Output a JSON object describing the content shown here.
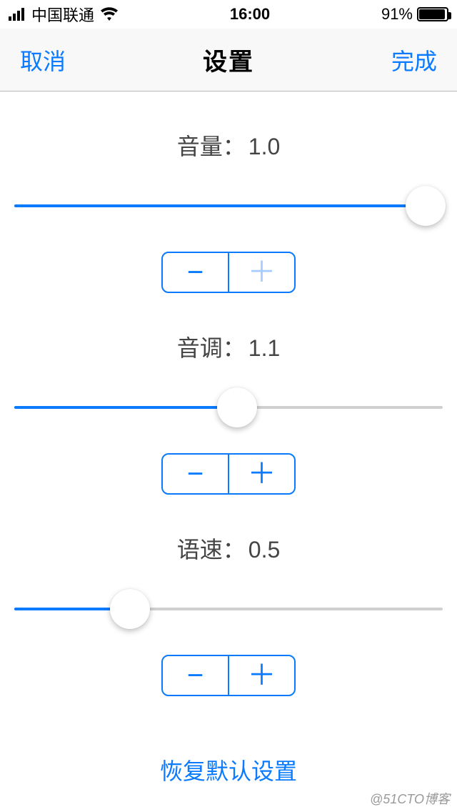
{
  "status": {
    "carrier": "中国联通",
    "time": "16:00",
    "battery_pct": "91%"
  },
  "nav": {
    "cancel": "取消",
    "title": "设置",
    "done": "完成"
  },
  "settings": {
    "volume": {
      "label": "音量",
      "value_text": "1.0",
      "value": 1.0,
      "fill_style": "width:100%",
      "thumb_style": "left:96%"
    },
    "pitch": {
      "label": "音调",
      "value_text": "1.1",
      "value": 1.1,
      "fill_style": "width:52%",
      "thumb_style": "left:52%"
    },
    "rate": {
      "label": "语速",
      "value_text": "0.5",
      "value": 0.5,
      "fill_style": "width:27%",
      "thumb_style": "left:27%"
    },
    "reset_label": "恢复默认设置"
  },
  "colors": {
    "accent": "#0a7aff"
  },
  "watermark": "@51CTO博客"
}
